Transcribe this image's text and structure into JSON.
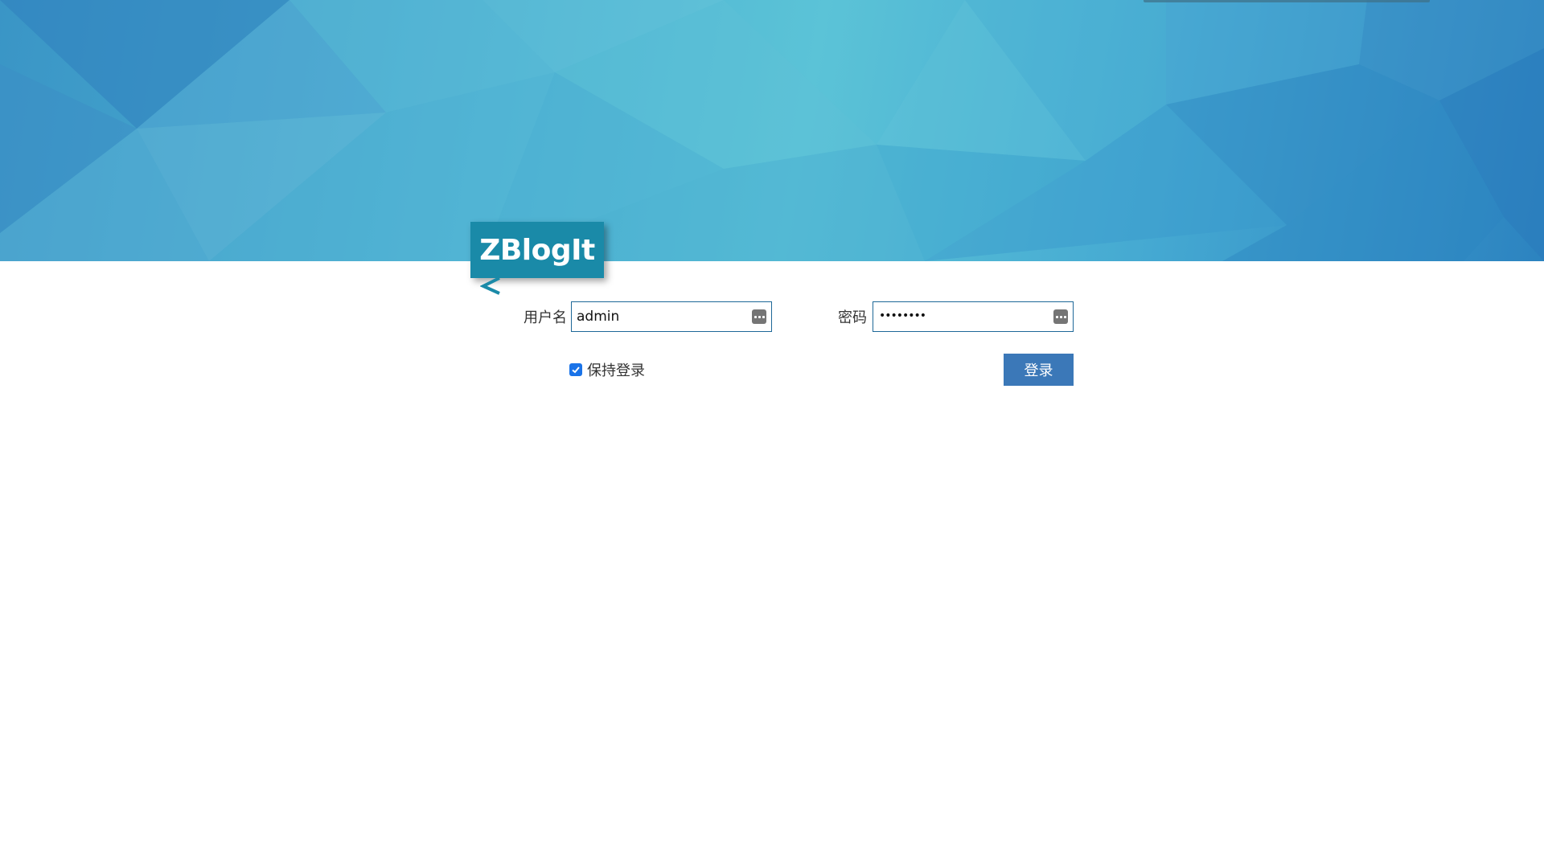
{
  "logo": {
    "text": "ZBlogIt"
  },
  "login_form": {
    "username_label": "用户名",
    "username_value": "admin",
    "password_label": "密码",
    "password_mask": "••••••••",
    "remember_label": "保持登录",
    "remember_checked": true,
    "submit_label": "登录"
  },
  "icons": {
    "username_autofill": "key-autofill-icon",
    "password_autofill": "key-autofill-icon",
    "remember": "checkmark-icon"
  },
  "colors": {
    "banner_light": "#5bc3d7",
    "banner_dark": "#2c83c0",
    "logo_bg": "#1a8aa8",
    "field_border": "#1e6898",
    "button_bg": "#3b78b8",
    "checkbox": "#1a73e8"
  }
}
